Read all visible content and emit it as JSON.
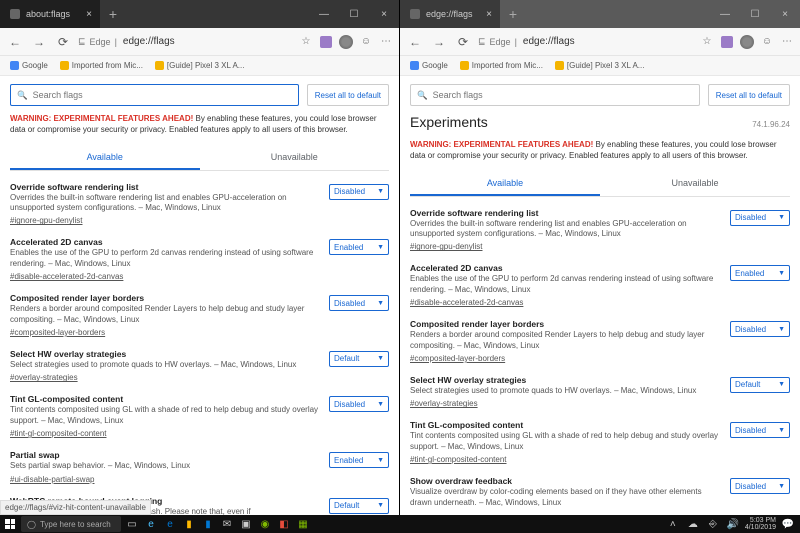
{
  "left": {
    "tab_title": "about:flags",
    "protocol_label": "Edge",
    "url": "edge://flags",
    "bookmarks": [
      {
        "label": "Google"
      },
      {
        "label": "Imported from Mic..."
      },
      {
        "label": "[Guide] Pixel 3 XL A..."
      }
    ],
    "search_placeholder": "Search flags",
    "reset_label": "Reset all to default",
    "warning_bold": "WARNING: EXPERIMENTAL FEATURES AHEAD!",
    "warning_body": " By enabling these features, you could lose browser data or compromise your security or privacy. Enabled features apply to all users of this browser.",
    "tab_available": "Available",
    "tab_unavailable": "Unavailable",
    "flags": [
      {
        "title": "Override software rendering list",
        "desc": "Overrides the built-in software rendering list and enables GPU-acceleration on unsupported system configurations. – Mac, Windows, Linux",
        "link": "#ignore-gpu-denylist",
        "value": "Disabled"
      },
      {
        "title": "Accelerated 2D canvas",
        "desc": "Enables the use of the GPU to perform 2d canvas rendering instead of using software rendering. – Mac, Windows, Linux",
        "link": "#disable-accelerated-2d-canvas",
        "value": "Enabled"
      },
      {
        "title": "Composited render layer borders",
        "desc": "Renders a border around composited Render Layers to help debug and study layer compositing. – Mac, Windows, Linux",
        "link": "#composited-layer-borders",
        "value": "Disabled"
      },
      {
        "title": "Select HW overlay strategies",
        "desc": "Select strategies used to promote quads to HW overlays. – Mac, Windows, Linux",
        "link": "#overlay-strategies",
        "value": "Default"
      },
      {
        "title": "Tint GL-composited content",
        "desc": "Tint contents composited using GL with a shade of red to help debug and study overlay support. – Mac, Windows, Linux",
        "link": "#tint-gl-composited-content",
        "value": "Disabled"
      },
      {
        "title": "Partial swap",
        "desc": "Sets partial swap behavior. – Mac, Windows, Linux",
        "link": "#ui-disable-partial-swap",
        "value": "Enabled"
      },
      {
        "title": "WebRTC remote-bound event logging",
        "desc": "... event logs and uploading them to Crash. Please note that, even if",
        "link": "",
        "value": "Default"
      }
    ],
    "status_text": "edge://flags/#viz-hit-content-unavailable"
  },
  "right": {
    "tab_title": "edge://flags",
    "protocol_label": "Edge",
    "url": "edge://flags",
    "bookmarks": [
      {
        "label": "Google"
      },
      {
        "label": "Imported from Mic..."
      },
      {
        "label": "[Guide] Pixel 3 XL A..."
      }
    ],
    "search_placeholder": "Search flags",
    "reset_label": "Reset all to default",
    "experiments_title": "Experiments",
    "version": "74.1.96.24",
    "warning_bold": "WARNING: EXPERIMENTAL FEATURES AHEAD!",
    "warning_body": " By enabling these features, you could lose browser data or compromise your security or privacy. Enabled features apply to all users of this browser.",
    "tab_available": "Available",
    "tab_unavailable": "Unavailable",
    "flags": [
      {
        "title": "Override software rendering list",
        "desc": "Overrides the built-in software rendering list and enables GPU-acceleration on unsupported system configurations. – Mac, Windows, Linux",
        "link": "#ignore-gpu-denylist",
        "value": "Disabled"
      },
      {
        "title": "Accelerated 2D canvas",
        "desc": "Enables the use of the GPU to perform 2d canvas rendering instead of using software rendering. – Mac, Windows, Linux",
        "link": "#disable-accelerated-2d-canvas",
        "value": "Enabled"
      },
      {
        "title": "Composited render layer borders",
        "desc": "Renders a border around composited Render Layers to help debug and study layer compositing. – Mac, Windows, Linux",
        "link": "#composited-layer-borders",
        "value": "Disabled"
      },
      {
        "title": "Select HW overlay strategies",
        "desc": "Select strategies used to promote quads to HW overlays. – Mac, Windows, Linux",
        "link": "#overlay-strategies",
        "value": "Default"
      },
      {
        "title": "Tint GL-composited content",
        "desc": "Tint contents composited using GL with a shade of red to help debug and study overlay support. – Mac, Windows, Linux",
        "link": "#tint-gl-composited-content",
        "value": "Disabled"
      },
      {
        "title": "Show overdraw feedback",
        "desc": "Visualize overdraw by color-coding elements based on if they have other elements drawn underneath. – Mac, Windows, Linux",
        "link": "",
        "value": "Disabled"
      }
    ]
  },
  "taskbar": {
    "search_placeholder": "Type here to search",
    "time": "5:03 PM",
    "date": "4/10/2019"
  }
}
